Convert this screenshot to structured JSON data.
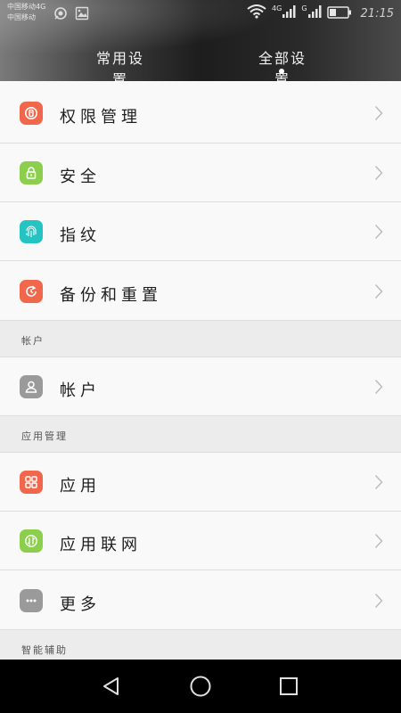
{
  "status_bar": {
    "carrier_1": "中国移动4G",
    "carrier_2": "中国移动",
    "network_4g": "4G",
    "network_g": "G",
    "time": "21:15"
  },
  "tabs": {
    "common": "常用设置",
    "all": "全部设置",
    "active": "all"
  },
  "rows": [
    {
      "id": "permission",
      "label": "权限管理",
      "icon": "permission-icon",
      "color": "#f0674b"
    },
    {
      "id": "security",
      "label": "安全",
      "icon": "lock-icon",
      "color": "#8ccf4d"
    },
    {
      "id": "fingerprint",
      "label": "指纹",
      "icon": "fingerprint-icon",
      "color": "#25c3c1"
    },
    {
      "id": "backup",
      "label": "备份和重置",
      "icon": "backup-restore-icon",
      "color": "#f0674b"
    }
  ],
  "sections": {
    "account": {
      "header": "帐户",
      "rows": [
        {
          "id": "account",
          "label": "帐户",
          "icon": "person-icon",
          "color": "#9a9a9a"
        }
      ]
    },
    "app_management": {
      "header": "应用管理",
      "rows": [
        {
          "id": "apps",
          "label": "应用",
          "icon": "apps-grid-icon",
          "color": "#f0674b"
        },
        {
          "id": "app_network",
          "label": "应用联网",
          "icon": "network-traffic-icon",
          "color": "#8ccf4d"
        },
        {
          "id": "more",
          "label": "更多",
          "icon": "more-dots-icon",
          "color": "#9a9a9a"
        }
      ]
    },
    "smart_assist": {
      "header": "智能辅助"
    }
  }
}
